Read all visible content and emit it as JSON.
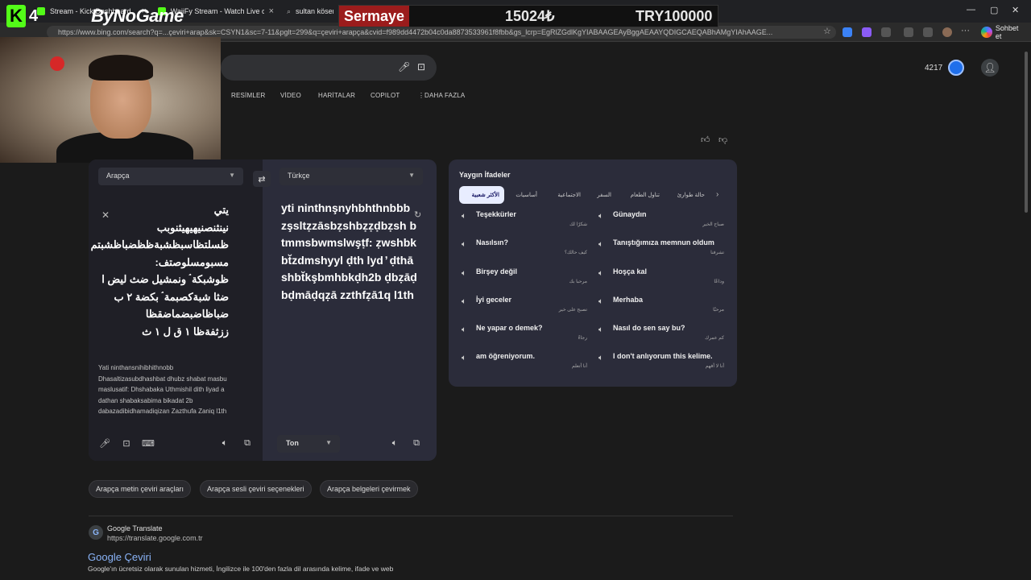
{
  "browser": {
    "tabs": [
      {
        "label": "Stream - Kick Dashboard"
      },
      {
        "label": "WaiiFy Stream - Watch Live on Kick"
      },
      {
        "label": "sultan kösen - A"
      }
    ],
    "url": "https://www.bing.com/search?q=...çeviri+arap&sk=CSYN1&sc=7-11&pglt=299&q=çeviri+arapça&cvid=f989dd4472b04c0da8873533961f8fbb&gs_lcrp=EgRlZGdlKgYIABAAGEAyBggAEAAYQDIGCAEQABhAMgYIAhAAGE...",
    "copilot_label": "Sohbet et"
  },
  "overlay": {
    "title": "Sermaye",
    "amount": "15024₺",
    "target": "TRY100000"
  },
  "brand": {
    "logo_letter": "K",
    "number": "4",
    "name": "ByNoGame"
  },
  "search_nav": {
    "items": [
      "RESİMLER",
      "VİDEO",
      "HARİTALAR",
      "COPILOT",
      "DAHA FAZLA"
    ]
  },
  "header": {
    "rewards_count": "4217"
  },
  "translator": {
    "source_lang": "Arapça",
    "target_lang": "Türkçe",
    "source_text": [
      "يتي",
      "نينثنصنيهيهيثنوبب",
      "ظسلتظاسبظشبةظظضباظشبتم",
      "مسبومسلوصتف:",
      "ظوشبكة ۘ ونمشيل ضث ليض ا",
      "ضثا شبةكصبمة ۘ بكضة ٢ ب",
      "ضباظاضبضماضقظا",
      "ززثفةظا ١ ق ل ١ ث"
    ],
    "source_translit": "Yati ninthansnihibhithnobb Dhasaltizasubdhashbat dhubz shabat masbu maslusatif: Dhshabaka Uthmishil dith liyad a dathan shabaksabima bikadat 2b dabazadibidhamadiqizan Zazthufa Zaniq l1th",
    "target_text": "yti ninthnşnyhbhthnbbb zşsltẓzāsbẓshbẓẓḍbẓsh btmmsbwmslwşṭf: ẓwshbkbt̆zdmshyyl ḍth lyd ̓ ḍthā shbt̆kşbmhbkḍh2b ḍbẓāḍbḍmāḍqẓā zzthfẓā1q l1th",
    "tone_label": "Ton"
  },
  "phrases": {
    "title": "Yaygın İfadeler",
    "tabs": [
      "الأكثر شعبية",
      "أساسيات",
      "الاجتماعية",
      "السفر",
      "تناول الطعام",
      "حالة طوارئ"
    ],
    "items": [
      {
        "tr": "Teşekkürler",
        "ar": "شكرًا لك"
      },
      {
        "tr": "Günaydın",
        "ar": "صباح الخير"
      },
      {
        "tr": "Nasılsın?",
        "ar": "كيف حالك؟"
      },
      {
        "tr": "Tanıştığımıza memnun oldum",
        "ar": "تشرفنا"
      },
      {
        "tr": "Birşey değil",
        "ar": "مرحبا بك"
      },
      {
        "tr": "Hoşça kal",
        "ar": "وداعًا"
      },
      {
        "tr": "İyi geceler",
        "ar": "تصبح على خير"
      },
      {
        "tr": "Merhaba",
        "ar": "مرحبًا"
      },
      {
        "tr": "Ne yapar o demek?",
        "ar": "رجاءً"
      },
      {
        "tr": "Nasıl do sen say bu?",
        "ar": "كم عمرك"
      },
      {
        "tr": "am öğreniyorum.",
        "ar": "أنا أتعلم"
      },
      {
        "tr": "I don't anlıyorum this kelime.",
        "ar": "أنا لا أفهم"
      }
    ]
  },
  "chips": [
    "Arapça metin çeviri araçları",
    "Arapça sesli çeviri seçenekleri",
    "Arapça belgeleri çevirmek"
  ],
  "result": {
    "site": "Google Translate",
    "url": "https://translate.google.com.tr",
    "title": "Google Çeviri",
    "desc": "Google'ın ücretsiz olarak sunulan hizmeti, İngilizce ile 100'den fazla dil arasında kelime, ifade ve web"
  }
}
